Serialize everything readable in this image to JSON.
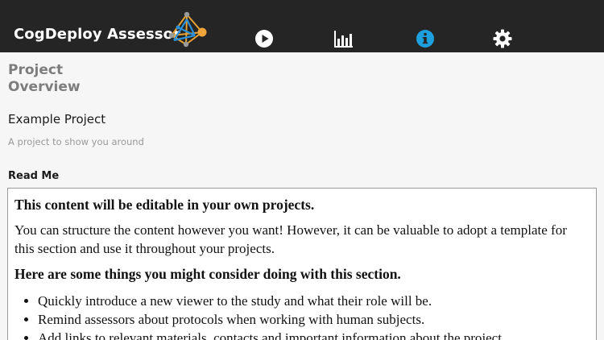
{
  "header": {
    "app_title": "CogDeploy Assessor",
    "logo_icon": "network-pyramid-logo",
    "nav": [
      {
        "icon": "play-circle-icon",
        "active": false
      },
      {
        "icon": "bar-chart-icon",
        "active": false
      },
      {
        "icon": "info-circle-icon",
        "active": true
      },
      {
        "icon": "gear-icon",
        "active": false
      }
    ],
    "colors": {
      "bar": "#252525",
      "active": "#1ea0de",
      "inactive": "#ffffff",
      "logo_accent": "#f0a030"
    }
  },
  "page": {
    "title": "Project Overview",
    "project_name": "Example Project",
    "project_description": "A project to show you around",
    "readme_label": "Read Me"
  },
  "readme": {
    "heading": "This content will be editable in your own projects.",
    "paragraph": "You can structure the content however you want! However, it can be valuable to adopt a template for this section and use it throughout your projects.",
    "heading2": "Here are some things you might consider doing with this section.",
    "items": [
      "Quickly introduce a new viewer to the study and what their role will be.",
      "Remind assessors about protocols when working with human subjects.",
      "Add links to relevant materials, contacts and important information about the project."
    ]
  }
}
